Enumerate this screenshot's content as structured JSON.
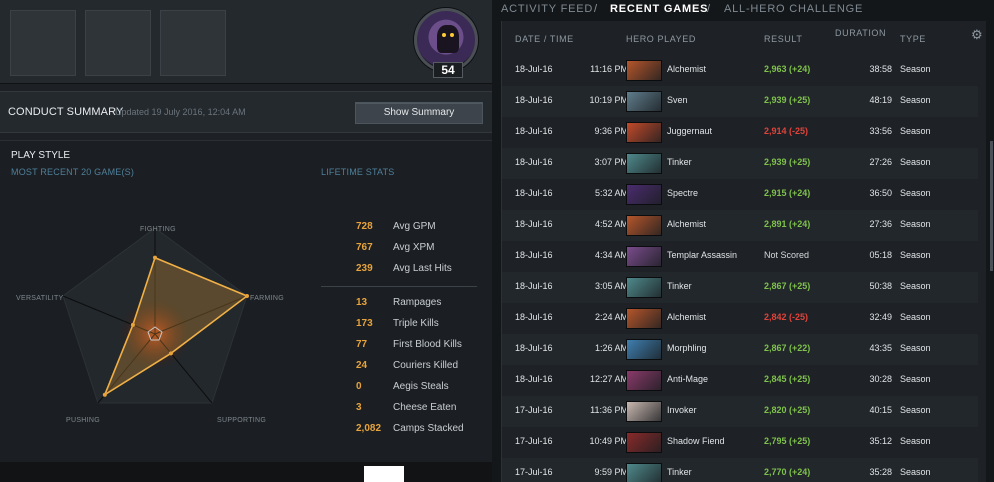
{
  "profile": {
    "level": "54"
  },
  "conduct": {
    "title": "CONDUCT SUMMARY",
    "updated": "Updated 19 July 2016, 12:04 AM",
    "button": "Show Summary"
  },
  "playstyle": {
    "title": "PLAY STYLE",
    "subtitle": "MOST RECENT 20 GAME(S)",
    "lifetime_title": "LIFETIME STATS",
    "axes": {
      "fighting": "FIGHTING",
      "farming": "FARMING",
      "supporting": "SUPPORTING",
      "pushing": "PUSHING",
      "versatility": "VERSATILITY"
    },
    "radar_levels": {
      "fighting": 0.72,
      "farming": 1.0,
      "supporting": 0.28,
      "pushing": 0.88,
      "versatility": 0.24
    },
    "radar_color": "#e8a33a"
  },
  "lifetime_stats": {
    "gpm": {
      "value": "728",
      "label": "Avg GPM"
    },
    "xpm": {
      "value": "767",
      "label": "Avg XPM"
    },
    "last_hits": {
      "value": "239",
      "label": "Avg Last Hits"
    },
    "rampages": {
      "value": "13",
      "label": "Rampages"
    },
    "triple_kills": {
      "value": "173",
      "label": "Triple Kills"
    },
    "first_blood": {
      "value": "77",
      "label": "First Blood Kills"
    },
    "couriers": {
      "value": "24",
      "label": "Couriers Killed"
    },
    "aegis": {
      "value": "0",
      "label": "Aegis Steals"
    },
    "cheese": {
      "value": "3",
      "label": "Cheese Eaten"
    },
    "camps": {
      "value": "2,082",
      "label": "Camps Stacked"
    }
  },
  "tabs": {
    "activity": "ACTIVITY FEED",
    "sep": "/",
    "recent": "RECENT GAMES",
    "allhero": "ALL-HERO CHALLENGE"
  },
  "games_header": {
    "date_time": "DATE / TIME",
    "hero": "HERO PLAYED",
    "result": "RESULT",
    "duration": "DURATION",
    "type": "TYPE"
  },
  "colors": {
    "win": "#7fc24b",
    "loss": "#e0433a",
    "accent": "#e8a33a"
  },
  "games": [
    {
      "date": "18-Jul-16",
      "time": "11:16 PM",
      "hero": "Alchemist",
      "result": "2,963 (+24)",
      "status": "win",
      "duration": "38:58",
      "type": "Season",
      "portrait": "#b5562b"
    },
    {
      "date": "18-Jul-16",
      "time": "10:19 PM",
      "hero": "Sven",
      "result": "2,939 (+25)",
      "status": "win",
      "duration": "48:19",
      "type": "Season",
      "portrait": "#5f7d8c"
    },
    {
      "date": "18-Jul-16",
      "time": "9:36 PM",
      "hero": "Juggernaut",
      "result": "2,914 (-25)",
      "status": "loss",
      "duration": "33:56",
      "type": "Season",
      "portrait": "#c24a2a"
    },
    {
      "date": "18-Jul-16",
      "time": "3:07 PM",
      "hero": "Tinker",
      "result": "2,939 (+25)",
      "status": "win",
      "duration": "27:26",
      "type": "Season",
      "portrait": "#4f8a8c"
    },
    {
      "date": "18-Jul-16",
      "time": "5:32 AM",
      "hero": "Spectre",
      "result": "2,915 (+24)",
      "status": "win",
      "duration": "36:50",
      "type": "Season",
      "portrait": "#4a2c6e"
    },
    {
      "date": "18-Jul-16",
      "time": "4:52 AM",
      "hero": "Alchemist",
      "result": "2,891 (+24)",
      "status": "win",
      "duration": "27:36",
      "type": "Season",
      "portrait": "#b5562b"
    },
    {
      "date": "18-Jul-16",
      "time": "4:34 AM",
      "hero": "Templar Assassin",
      "result": "Not Scored",
      "status": "ns",
      "duration": "05:18",
      "type": "Season",
      "portrait": "#7a4c8c"
    },
    {
      "date": "18-Jul-16",
      "time": "3:05 AM",
      "hero": "Tinker",
      "result": "2,867 (+25)",
      "status": "win",
      "duration": "50:38",
      "type": "Season",
      "portrait": "#4f8a8c"
    },
    {
      "date": "18-Jul-16",
      "time": "2:24 AM",
      "hero": "Alchemist",
      "result": "2,842 (-25)",
      "status": "loss",
      "duration": "32:49",
      "type": "Season",
      "portrait": "#b5562b"
    },
    {
      "date": "18-Jul-16",
      "time": "1:26 AM",
      "hero": "Morphling",
      "result": "2,867 (+22)",
      "status": "win",
      "duration": "43:35",
      "type": "Season",
      "portrait": "#3f7fb0"
    },
    {
      "date": "18-Jul-16",
      "time": "12:27 AM",
      "hero": "Anti-Mage",
      "result": "2,845 (+25)",
      "status": "win",
      "duration": "30:28",
      "type": "Season",
      "portrait": "#8a3a6a"
    },
    {
      "date": "17-Jul-16",
      "time": "11:36 PM",
      "hero": "Invoker",
      "result": "2,820 (+25)",
      "status": "win",
      "duration": "40:15",
      "type": "Season",
      "portrait": "#c9b8b0"
    },
    {
      "date": "17-Jul-16",
      "time": "10:49 PM",
      "hero": "Shadow Fiend",
      "result": "2,795 (+25)",
      "status": "win",
      "duration": "35:12",
      "type": "Season",
      "portrait": "#8a2a2a"
    },
    {
      "date": "17-Jul-16",
      "time": "9:59 PM",
      "hero": "Tinker",
      "result": "2,770 (+24)",
      "status": "win",
      "duration": "35:28",
      "type": "Season",
      "portrait": "#4f8a8c"
    }
  ]
}
